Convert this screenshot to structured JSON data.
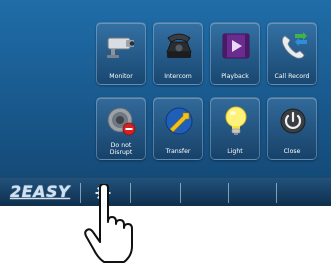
{
  "brand": {
    "logo_text": "2EASY"
  },
  "menu": {
    "tiles": [
      {
        "label": "Monitor",
        "icon": "camera-icon"
      },
      {
        "label": "Intercom",
        "icon": "phone-icon"
      },
      {
        "label": "Playback",
        "icon": "playback-icon"
      },
      {
        "label": "Call Record",
        "icon": "call-record-icon"
      },
      {
        "label": "Do not\nDisrupt",
        "icon": "do-not-disturb-icon"
      },
      {
        "label": "Transfer",
        "icon": "transfer-icon"
      },
      {
        "label": "Light",
        "icon": "lightbulb-icon"
      },
      {
        "label": "Close",
        "icon": "power-icon"
      }
    ]
  },
  "taskbar": {
    "settings_icon": "gear-icon"
  },
  "overlay": {
    "pointer_icon": "hand-pointer-icon"
  },
  "colors": {
    "screen_top": "#1f6da8",
    "screen_bottom": "#124570",
    "taskbar": "#0f2f4d",
    "tile_text": "#ffffff"
  }
}
